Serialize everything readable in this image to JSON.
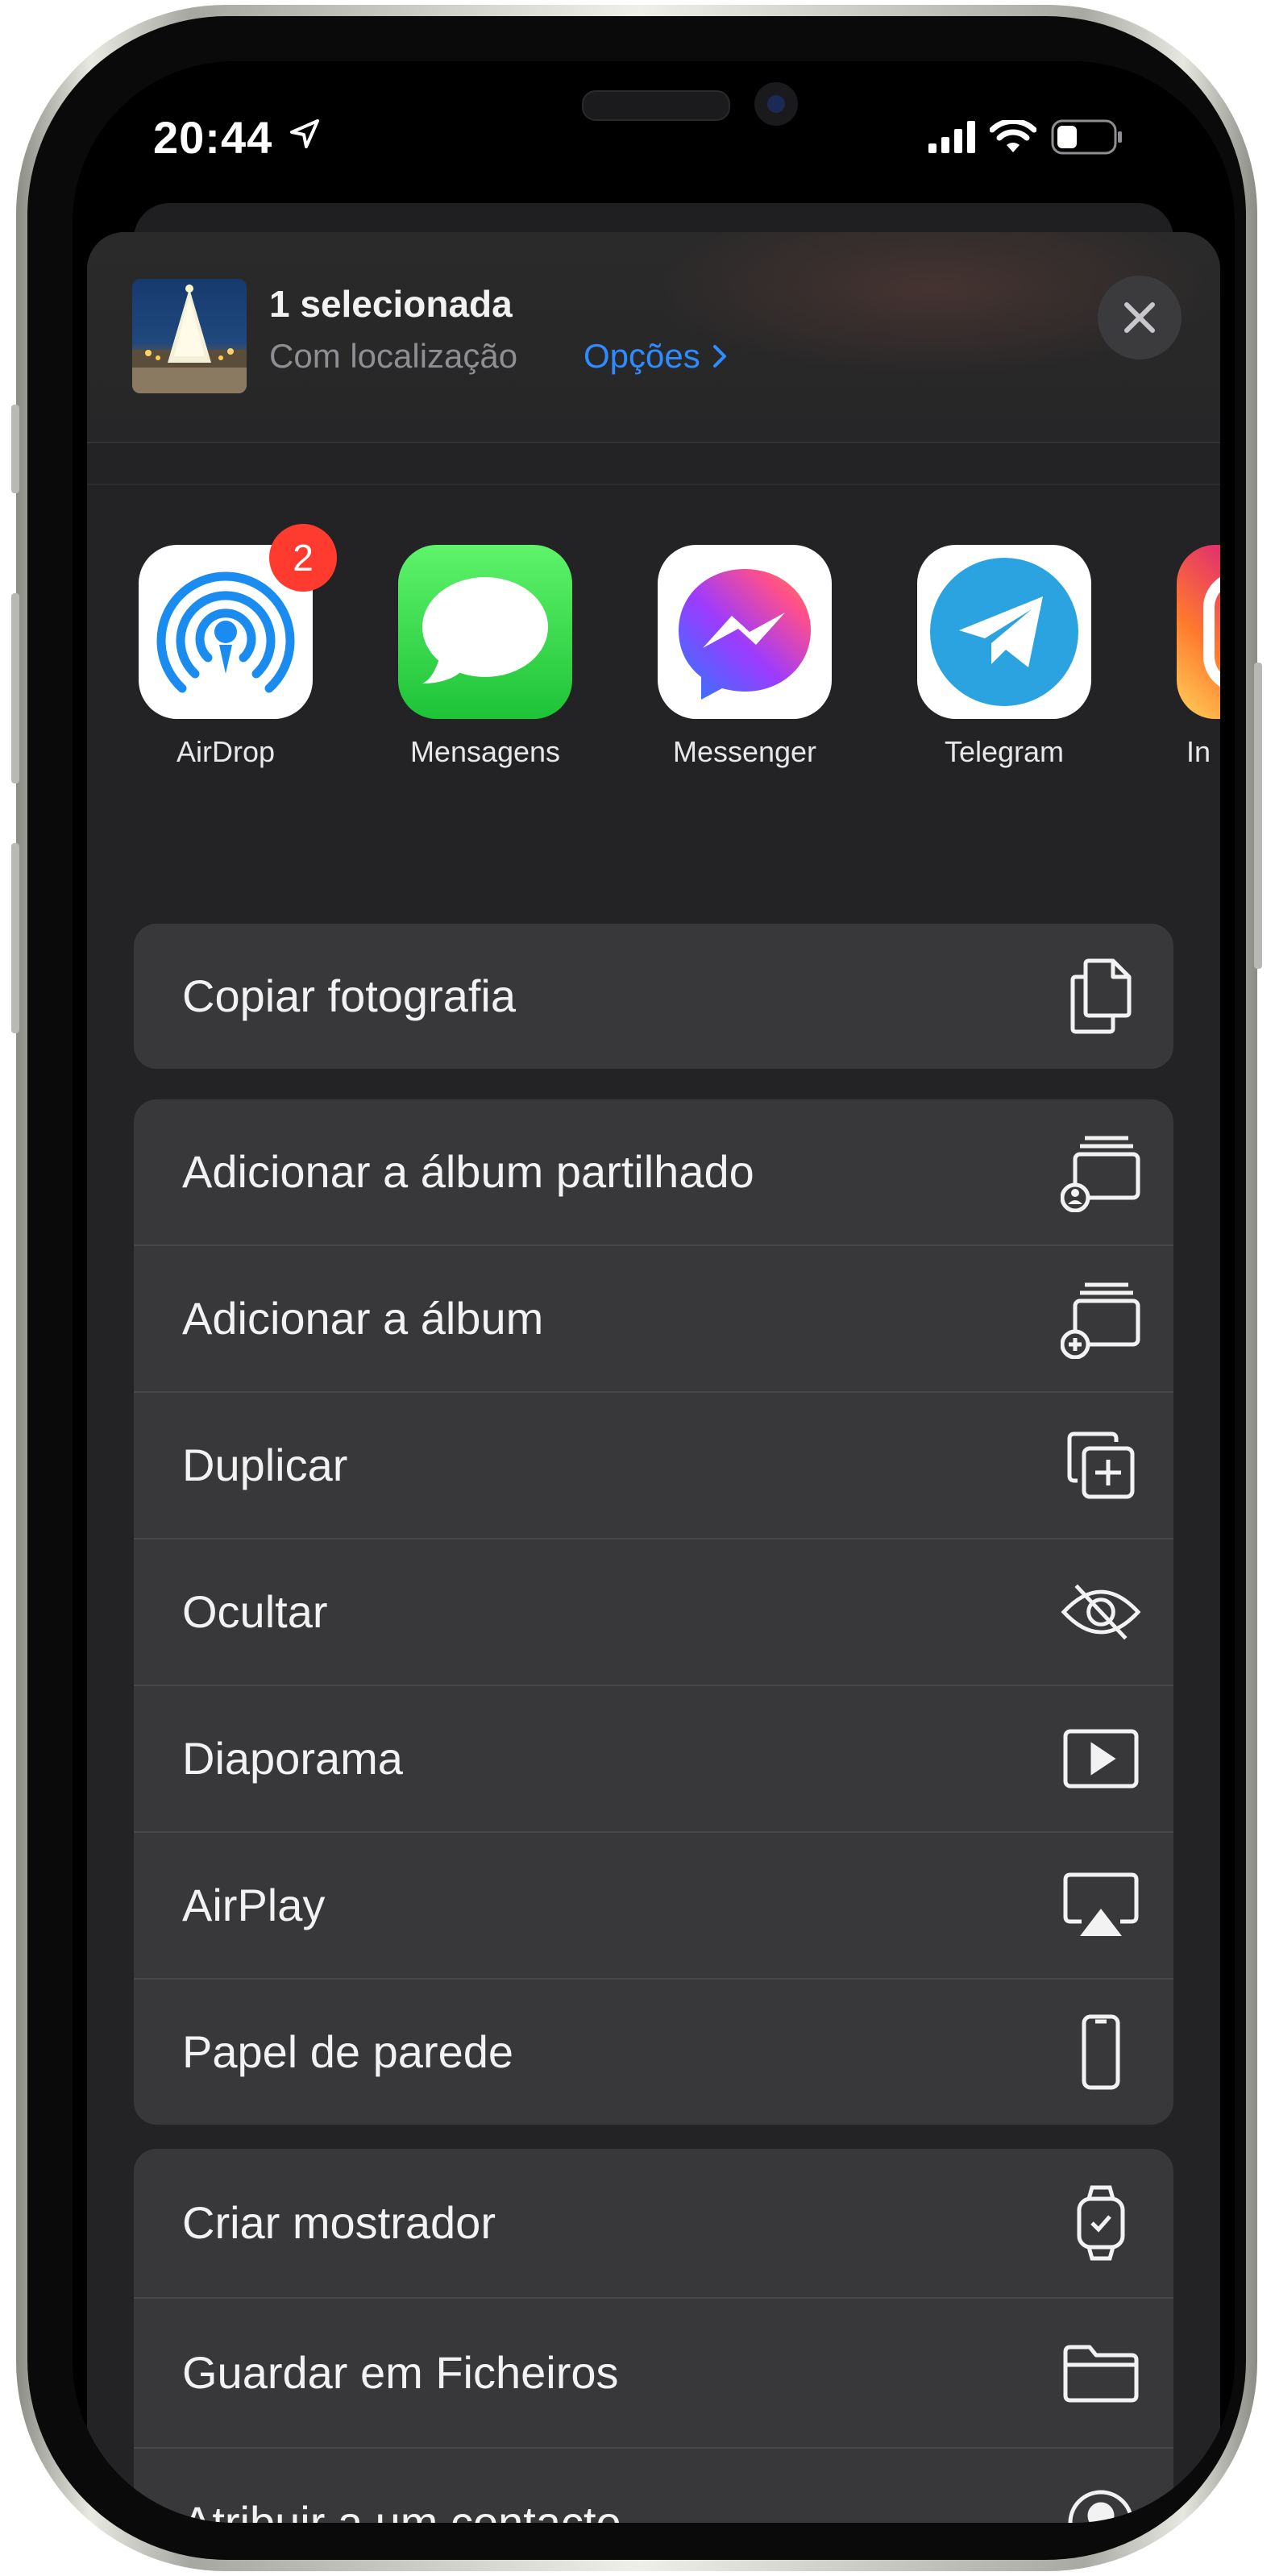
{
  "status_bar": {
    "time": "20:44"
  },
  "share_sheet": {
    "header": {
      "title": "1 selecionada",
      "subtitle": "Com localização",
      "options_label": "Opções"
    },
    "apps": [
      {
        "label": "AirDrop",
        "icon": "airdrop-icon",
        "badge": "2"
      },
      {
        "label": "Mensagens",
        "icon": "messages-icon"
      },
      {
        "label": "Messenger",
        "icon": "messenger-icon"
      },
      {
        "label": "Telegram",
        "icon": "telegram-icon"
      },
      {
        "label": "In",
        "icon": "instagram-icon"
      }
    ],
    "group1": [
      {
        "label": "Copiar fotografia",
        "icon": "copy-icon"
      }
    ],
    "group2": [
      {
        "label": "Adicionar a álbum partilhado",
        "icon": "shared-album-icon"
      },
      {
        "label": "Adicionar a álbum",
        "icon": "add-album-icon"
      },
      {
        "label": "Duplicar",
        "icon": "duplicate-icon"
      },
      {
        "label": "Ocultar",
        "icon": "eye-slash-icon"
      },
      {
        "label": "Diaporama",
        "icon": "slideshow-icon"
      },
      {
        "label": "AirPlay",
        "icon": "airplay-icon"
      },
      {
        "label": "Papel de parede",
        "icon": "iphone-icon"
      }
    ],
    "group3": [
      {
        "label": "Criar mostrador",
        "icon": "watch-icon"
      },
      {
        "label": "Guardar em Ficheiros",
        "icon": "folder-icon"
      },
      {
        "label": "Atribuir a um contacto",
        "icon": "contact-icon"
      }
    ]
  },
  "colors": {
    "accent": "#2e8cff",
    "badge": "#ff3b30",
    "sheet_bg": "#232325",
    "row_bg": "#38383a"
  }
}
